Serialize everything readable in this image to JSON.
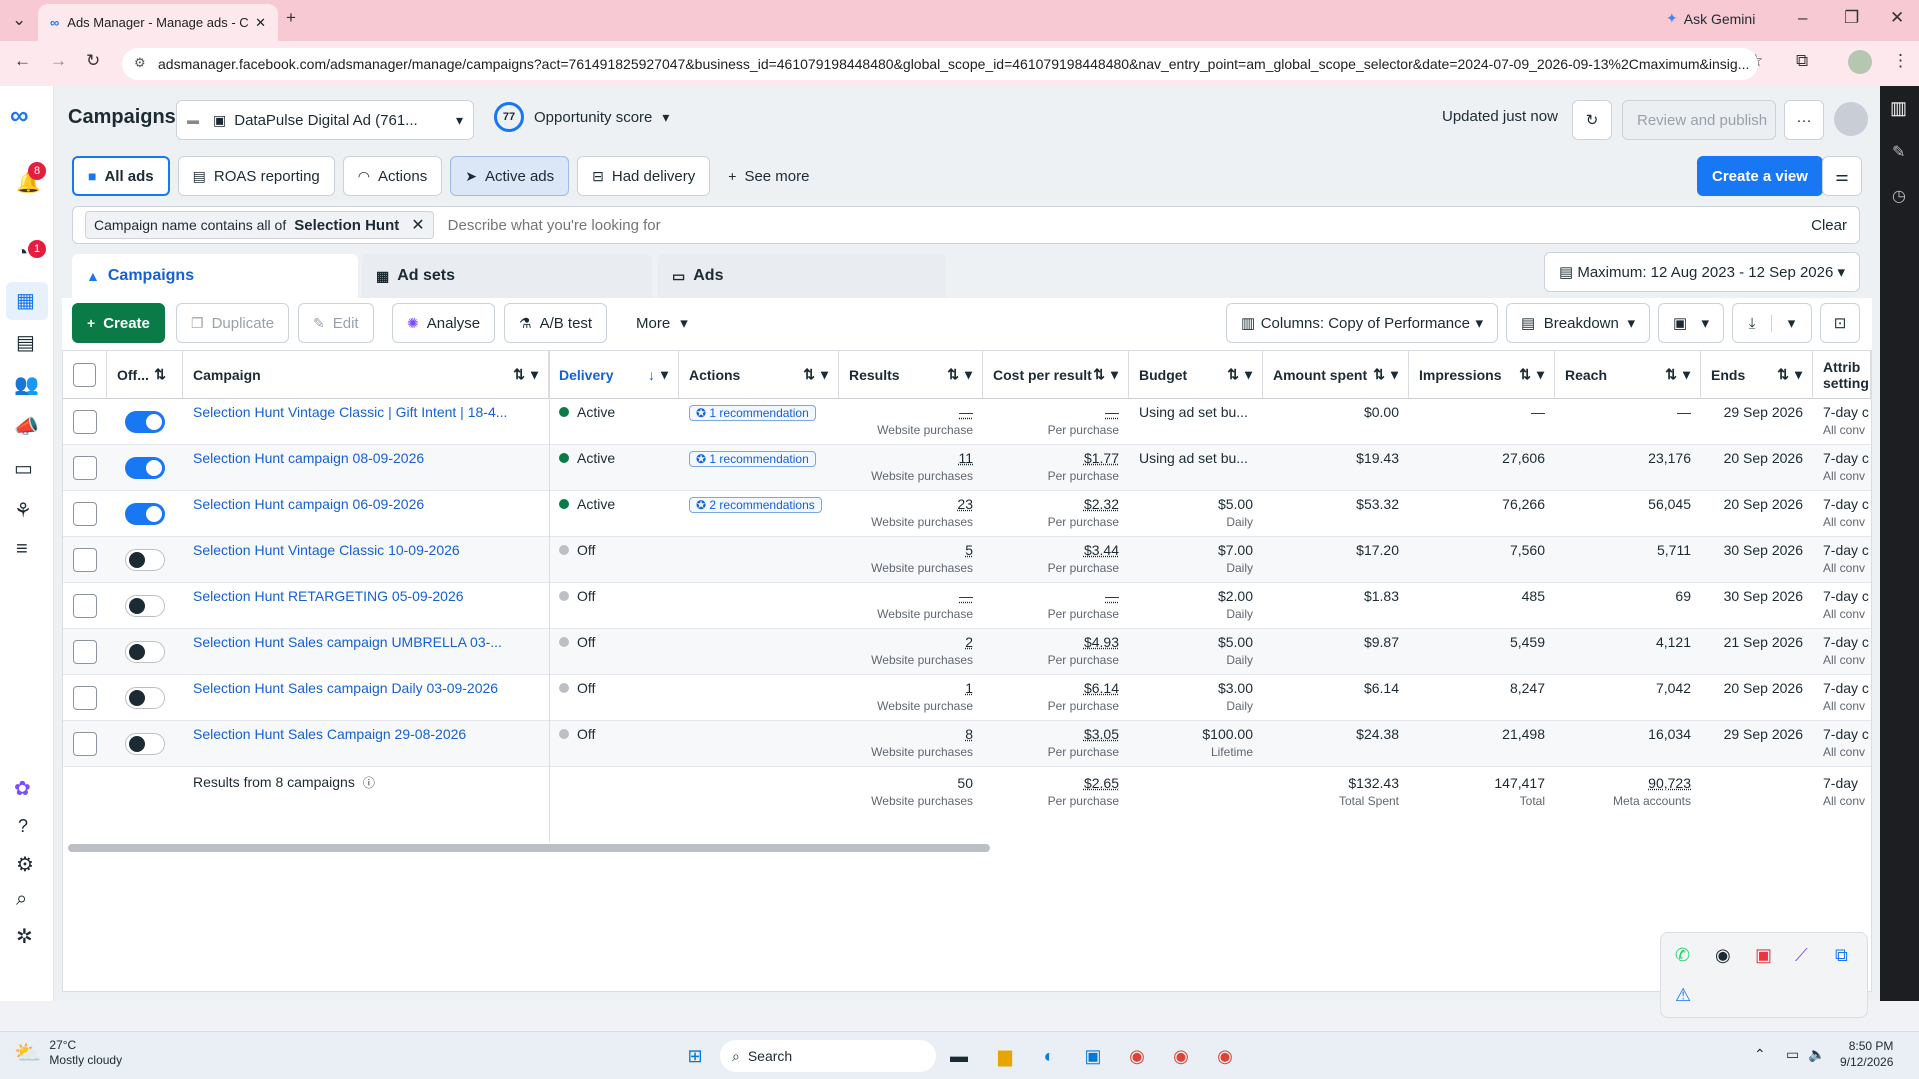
{
  "browser": {
    "tab_title": "Ads Manager - Manage ads - C",
    "url": "adsmanager.facebook.com/adsmanager/manage/campaigns?act=761491825927047&business_id=461079198448480&global_scope_id=461079198448480&nav_entry_point=am_global_scope_selector&date=2024-07-09_2026-09-13%2Cmaximum&insig...",
    "ask_gemini": "Ask Gemini"
  },
  "header": {
    "title": "Campaigns",
    "account": "DataPulse Digital Ad (761...",
    "opportunity_score": "77",
    "opportunity_label": "Opportunity score",
    "updated": "Updated just now",
    "review_publish": "Review and publish",
    "notif_count": "8",
    "alert_count": "1"
  },
  "views": {
    "items": [
      "All ads",
      "ROAS reporting",
      "Actions",
      "Active ads",
      "Had delivery",
      "See more"
    ],
    "create_view": "Create a view"
  },
  "filter": {
    "prefix": "Campaign name contains all of",
    "value": "Selection Hunt",
    "placeholder": "Describe what you're looking for",
    "clear": "Clear"
  },
  "tabs": [
    "Campaigns",
    "Ad sets",
    "Ads"
  ],
  "date_range": "Maximum: 12 Aug 2023 - 12 Sep 2026",
  "toolbar": {
    "create": "Create",
    "duplicate": "Duplicate",
    "edit": "Edit",
    "analyse": "Analyse",
    "ab_test": "A/B test",
    "more": "More",
    "columns": "Columns: Copy of Performance",
    "breakdown": "Breakdown"
  },
  "columns": [
    "Off...",
    "Campaign",
    "Delivery",
    "Actions",
    "Results",
    "Cost per result",
    "Budget",
    "Amount spent",
    "Impressions",
    "Reach",
    "Ends",
    "Attrib setting"
  ],
  "rows": [
    {
      "on": true,
      "name": "Selection Hunt Vintage Classic | Gift Intent | 18-4...",
      "delivery": "Active",
      "actions": "1 recommendation",
      "results": "—",
      "results_sub": "Website purchase",
      "cpr": "—",
      "cpr_sub": "Per purchase",
      "budget": "Using ad set bu...",
      "budget_sub": "",
      "spent": "$0.00",
      "impressions": "—",
      "reach": "—",
      "ends": "29 Sep 2026",
      "attrib": "7-day c",
      "attrib_sub": "All conv"
    },
    {
      "on": true,
      "name": "Selection Hunt campaign 08-09-2026",
      "delivery": "Active",
      "actions": "1 recommendation",
      "results": "11",
      "results_sub": "Website purchases",
      "cpr": "$1.77",
      "cpr_sub": "Per purchase",
      "budget": "Using ad set bu...",
      "budget_sub": "",
      "spent": "$19.43",
      "impressions": "27,606",
      "reach": "23,176",
      "ends": "20 Sep 2026",
      "attrib": "7-day c",
      "attrib_sub": "All conv"
    },
    {
      "on": true,
      "name": "Selection Hunt campaign 06-09-2026",
      "delivery": "Active",
      "actions": "2 recommendations",
      "results": "23",
      "results_sub": "Website purchases",
      "cpr": "$2.32",
      "cpr_sub": "Per purchase",
      "budget": "$5.00",
      "budget_sub": "Daily",
      "spent": "$53.32",
      "impressions": "76,266",
      "reach": "56,045",
      "ends": "20 Sep 2026",
      "attrib": "7-day c",
      "attrib_sub": "All conv"
    },
    {
      "on": false,
      "name": "Selection Hunt Vintage Classic 10-09-2026",
      "delivery": "Off",
      "actions": "",
      "results": "5",
      "results_sub": "Website purchases",
      "cpr": "$3.44",
      "cpr_sub": "Per purchase",
      "budget": "$7.00",
      "budget_sub": "Daily",
      "spent": "$17.20",
      "impressions": "7,560",
      "reach": "5,711",
      "ends": "30 Sep 2026",
      "attrib": "7-day c",
      "attrib_sub": "All conv"
    },
    {
      "on": false,
      "name": "Selection Hunt RETARGETING 05-09-2026",
      "delivery": "Off",
      "actions": "",
      "results": "—",
      "results_sub": "Website purchase",
      "cpr": "—",
      "cpr_sub": "Per purchase",
      "budget": "$2.00",
      "budget_sub": "Daily",
      "spent": "$1.83",
      "impressions": "485",
      "reach": "69",
      "ends": "30 Sep 2026",
      "attrib": "7-day c",
      "attrib_sub": "All conv"
    },
    {
      "on": false,
      "name": "Selection Hunt Sales campaign UMBRELLA 03-...",
      "delivery": "Off",
      "actions": "",
      "results": "2",
      "results_sub": "Website purchases",
      "cpr": "$4.93",
      "cpr_sub": "Per purchase",
      "budget": "$5.00",
      "budget_sub": "Daily",
      "spent": "$9.87",
      "impressions": "5,459",
      "reach": "4,121",
      "ends": "21 Sep 2026",
      "attrib": "7-day c",
      "attrib_sub": "All conv"
    },
    {
      "on": false,
      "name": "Selection Hunt Sales campaign Daily 03-09-2026",
      "delivery": "Off",
      "actions": "",
      "results": "1",
      "results_sub": "Website purchase",
      "cpr": "$6.14",
      "cpr_sub": "Per purchase",
      "budget": "$3.00",
      "budget_sub": "Daily",
      "spent": "$6.14",
      "impressions": "8,247",
      "reach": "7,042",
      "ends": "20 Sep 2026",
      "attrib": "7-day c",
      "attrib_sub": "All conv"
    },
    {
      "on": false,
      "name": "Selection Hunt Sales Campaign 29-08-2026",
      "delivery": "Off",
      "actions": "",
      "results": "8",
      "results_sub": "Website purchases",
      "cpr": "$3.05",
      "cpr_sub": "Per purchase",
      "budget": "$100.00",
      "budget_sub": "Lifetime",
      "spent": "$24.38",
      "impressions": "21,498",
      "reach": "16,034",
      "ends": "29 Sep 2026",
      "attrib": "7-day c",
      "attrib_sub": "All conv"
    }
  ],
  "totals": {
    "label": "Results from 8 campaigns",
    "results": "50",
    "results_sub": "Website purchases",
    "cpr": "$2.65",
    "cpr_sub": "Per purchase",
    "spent": "$132.43",
    "spent_sub": "Total Spent",
    "impressions": "147,417",
    "impressions_sub": "Total",
    "reach": "90,723",
    "reach_sub": "Meta accounts",
    "attrib": "7-day",
    "attrib_sub": "All conv"
  },
  "taskbar": {
    "weather_temp": "27°C",
    "weather_desc": "Mostly cloudy",
    "search": "Search",
    "time": "8:50 PM",
    "date": "9/12/2026"
  },
  "colors": {
    "accent": "#1877f2",
    "active_dot": "#0a7b47",
    "off_dot": "#bcc0c4",
    "create_green": "#0a7b47"
  }
}
